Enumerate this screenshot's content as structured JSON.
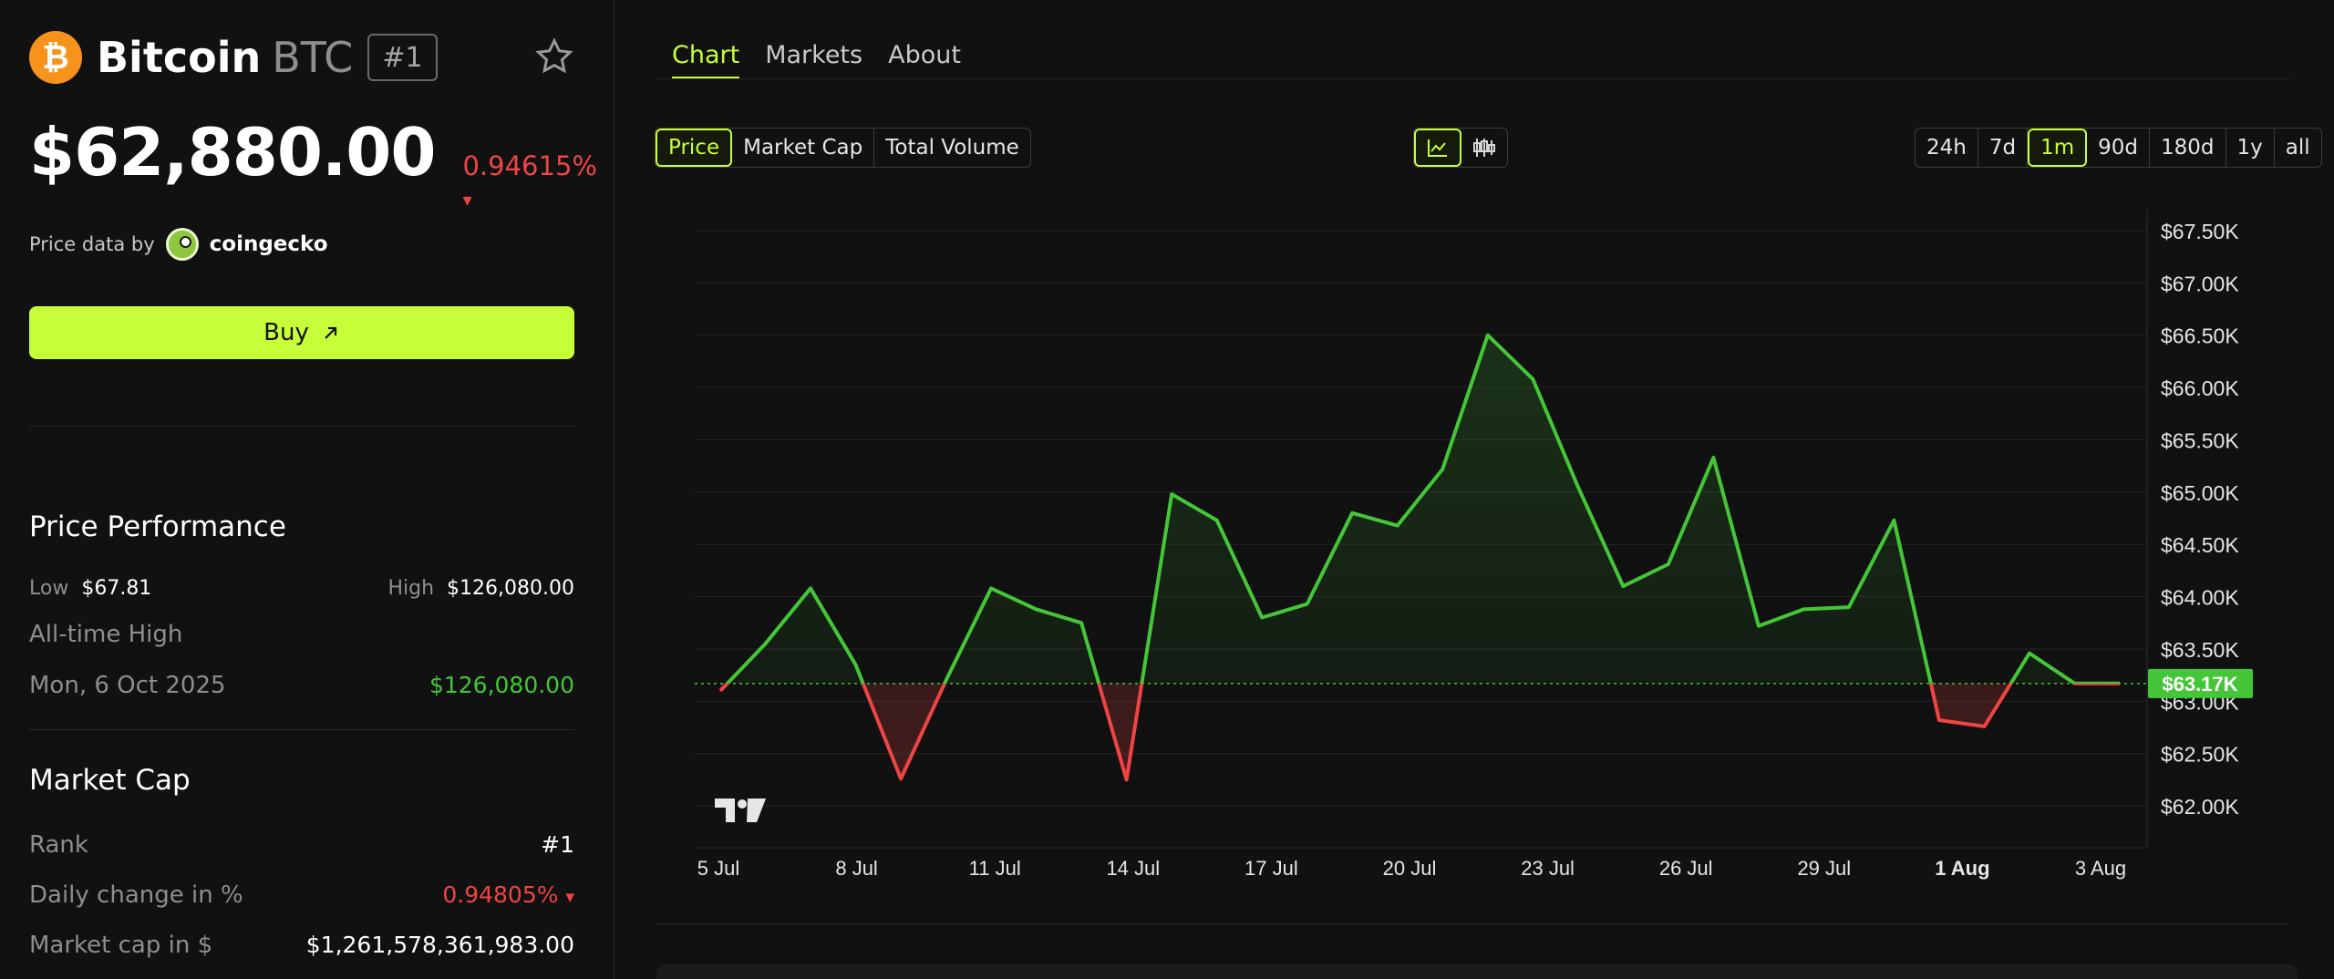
{
  "coin": {
    "name": "Bitcoin",
    "symbol": "BTC",
    "rank": "#1",
    "logo_glyph": "₿",
    "price": "$62,880.00",
    "change": "0.94615%",
    "change_arrow": "▾"
  },
  "price_data": {
    "label": "Price data by",
    "provider": "coingecko"
  },
  "buy": {
    "label": "Buy"
  },
  "performance": {
    "title": "Price Performance",
    "low_label": "Low",
    "low_value": "$67.81",
    "high_label": "High",
    "high_value": "$126,080.00",
    "ath_label": "All-time High",
    "ath_date": "Mon, 6 Oct 2025",
    "ath_value": "$126,080.00"
  },
  "market_cap": {
    "title": "Market Cap",
    "rank_label": "Rank",
    "rank_value": "#1",
    "daily_label": "Daily change in %",
    "daily_value": "0.94805%",
    "daily_arrow": "▾",
    "cap_label": "Market cap in $",
    "cap_value": "$1,261,578,361,983.00"
  },
  "tabs": [
    {
      "label": "Chart",
      "active": true
    },
    {
      "label": "Markets",
      "active": false
    },
    {
      "label": "About",
      "active": false
    }
  ],
  "metric_options": [
    {
      "label": "Price",
      "active": true
    },
    {
      "label": "Market Cap",
      "active": false
    },
    {
      "label": "Total Volume",
      "active": false
    }
  ],
  "chart_type_options": [
    {
      "icon": "line-chart-icon",
      "active": true
    },
    {
      "icon": "candlestick-icon",
      "active": false
    }
  ],
  "range_options": [
    {
      "label": "24h",
      "active": false
    },
    {
      "label": "7d",
      "active": false
    },
    {
      "label": "1m",
      "active": true
    },
    {
      "label": "90d",
      "active": false
    },
    {
      "label": "180d",
      "active": false
    },
    {
      "label": "1y",
      "active": false
    },
    {
      "label": "all",
      "active": false
    }
  ],
  "colors": {
    "accent": "#c6ff3a",
    "up": "#44c638",
    "down": "#ef4444",
    "bitcoin": "#f7931a",
    "background": "#111111"
  },
  "chart_data": {
    "type": "line",
    "x_tick_labels": [
      "5 Jul",
      "8 Jul",
      "11 Jul",
      "14 Jul",
      "17 Jul",
      "20 Jul",
      "23 Jul",
      "26 Jul",
      "29 Jul",
      "1 Aug",
      "3 Aug"
    ],
    "y_tick_labels": [
      "$67.50K",
      "$67.00K",
      "$66.50K",
      "$66.00K",
      "$65.50K",
      "$65.00K",
      "$64.50K",
      "$64.00K",
      "$63.50K",
      "$63.00K",
      "$62.50K",
      "$62.00K"
    ],
    "ylim": [
      61600,
      67700
    ],
    "baseline": 63170,
    "baseline_label": "$63.17K",
    "x": [
      "2024-07-05",
      "2024-07-06",
      "2024-07-07",
      "2024-07-08",
      "2024-07-09",
      "2024-07-10",
      "2024-07-11",
      "2024-07-12",
      "2024-07-13",
      "2024-07-14",
      "2024-07-15",
      "2024-07-16",
      "2024-07-17",
      "2024-07-18",
      "2024-07-19",
      "2024-07-20",
      "2024-07-21",
      "2024-07-22",
      "2024-07-23",
      "2024-07-24",
      "2024-07-25",
      "2024-07-26",
      "2024-07-27",
      "2024-07-28",
      "2024-07-29",
      "2024-07-30",
      "2024-07-31",
      "2024-08-01",
      "2024-08-02",
      "2024-08-03",
      "2024-08-04",
      "2024-08-05"
    ],
    "values": [
      63100,
      63550,
      64080,
      63350,
      62260,
      63200,
      64080,
      63880,
      63750,
      62250,
      64980,
      64730,
      63800,
      63930,
      64800,
      64680,
      65220,
      66500,
      66080,
      65050,
      64100,
      64310,
      65330,
      63720,
      63880,
      63900,
      64730,
      62820,
      62760,
      63460,
      63170,
      63170
    ],
    "grid": true,
    "watermark": "TV",
    "xlabel": "",
    "ylabel": ""
  }
}
